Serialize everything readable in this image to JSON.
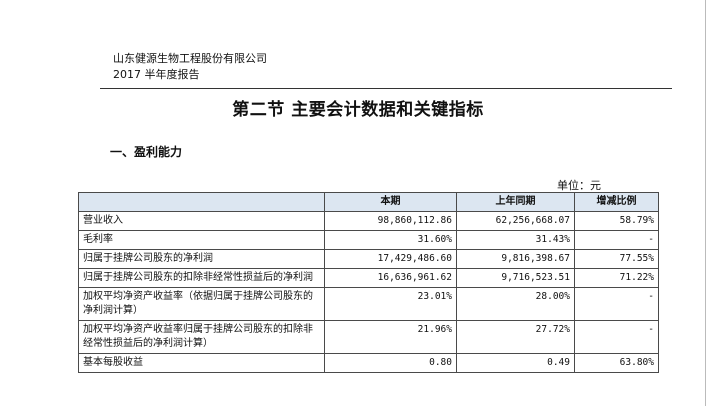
{
  "header": {
    "company": "山东健源生物工程股份有限公司",
    "report": "2017 半年度报告"
  },
  "section_title": "第二节 主要会计数据和关键指标",
  "sub_title": "一、盈利能力",
  "unit": "单位：元",
  "table": {
    "columns": [
      "",
      "本期",
      "上年同期",
      "增减比例"
    ],
    "rows": [
      {
        "name": "营业收入",
        "current": "98,860,112.86",
        "prior": "62,256,668.07",
        "change": "58.79%"
      },
      {
        "name": "毛利率",
        "current": "31.60%",
        "prior": "31.43%",
        "change": "-"
      },
      {
        "name": "归属于挂牌公司股东的净利润",
        "current": "17,429,486.60",
        "prior": "9,816,398.67",
        "change": "77.55%"
      },
      {
        "name": "归属于挂牌公司股东的扣除非经常性损益后的净利润",
        "current": "16,636,961.62",
        "prior": "9,716,523.51",
        "change": "71.22%"
      },
      {
        "name": "加权平均净资产收益率（依据归属于挂牌公司股东的净利润计算）",
        "current": "23.01%",
        "prior": "28.00%",
        "change": "-"
      },
      {
        "name": "加权平均净资产收益率归属于挂牌公司股东的扣除非经常性损益后的净利润计算）",
        "current": "21.96%",
        "prior": "27.72%",
        "change": "-"
      },
      {
        "name": "基本每股收益",
        "current": "0.80",
        "prior": "0.49",
        "change": "63.80%"
      }
    ]
  }
}
